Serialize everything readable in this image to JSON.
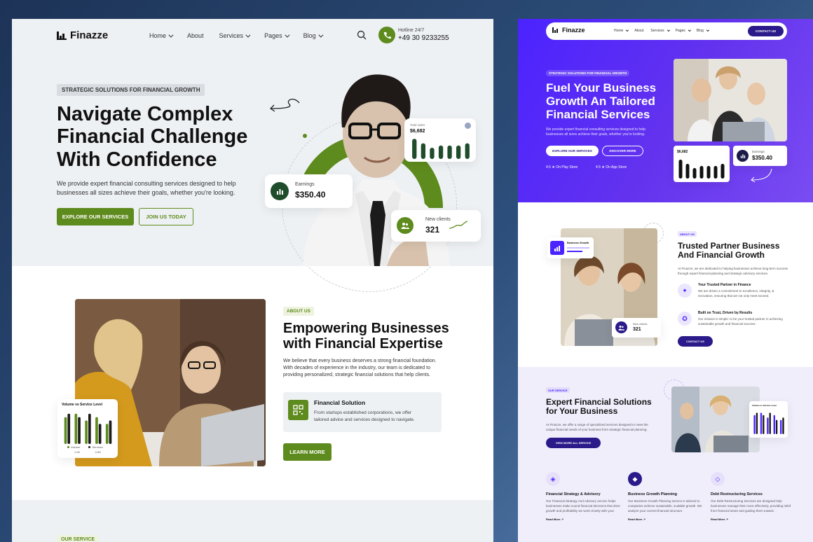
{
  "left": {
    "brand": "Finazze",
    "nav": [
      {
        "label": "Home"
      },
      {
        "label": "About"
      },
      {
        "label": "Services"
      },
      {
        "label": "Pages"
      },
      {
        "label": "Blog"
      }
    ],
    "hotline_label": "Hotline 24/7",
    "hotline_number": "+49 30 9233255",
    "hero": {
      "tag": "STRATEGIC SOLUTIONS FOR FINANCIAL GROWTH",
      "title_l1": "Navigate Complex",
      "title_l2": "Financial Challenge",
      "title_l3": "With Confidence",
      "desc_l1": "We provide expert financial consulting services designed to help",
      "desc_l2": "businesses all sizes achieve their goals, whether you're looking.",
      "btn_primary": "EXPLORE OUR SERVICES",
      "btn_secondary": "JOIN US TODAY",
      "stat_total_label": "Total sales",
      "stat_total_value": "$6,682",
      "earnings_label": "Earnings",
      "earnings_value": "$350.40",
      "clients_label": "New clients",
      "clients_value": "321"
    },
    "about": {
      "tag": "ABOUT US",
      "title_l1": "Empowering Businesses",
      "title_l2": "with Financial Expertise",
      "desc_l1": "We believe that every business deserves a strong financial foundation.",
      "desc_l2": "With decades of experience in the industry, our team is dedicated to",
      "desc_l3": "providing personalized, strategic financial solutions that help clients.",
      "feature_title": "Financial Solution",
      "feature_l1": "From startups established corporations, we offer",
      "feature_l2": "tailored advice and services designed to navigate.",
      "btn": "LEARN MORE",
      "chart_label": "Volume vs Service Level",
      "legend_a": "Volume",
      "legend_b": "Services",
      "legend_a_val": "1.05",
      "legend_b_val": "0.85"
    },
    "service_tag": "OUR SERVICE"
  },
  "right": {
    "brand": "Finazze",
    "nav": [
      {
        "label": "Home"
      },
      {
        "label": "About"
      },
      {
        "label": "Services"
      },
      {
        "label": "Pages"
      },
      {
        "label": "Blog"
      }
    ],
    "contact_btn": "CONTACT US",
    "hero": {
      "tag": "STRATEGIC SOLUTIONS FOR FINANCIAL GROWTH",
      "title_l1": "Fuel Your Business",
      "title_l2": "Growth An Tailored",
      "title_l3": "Financial Services",
      "desc_l1": "We provide expert financial consulting services designed to help",
      "desc_l2": "businesses all sizes achieve their goals, whether you're looking.",
      "btn_a": "EXPLORE OUR SERVICES",
      "btn_b": "DISCOVER MORE",
      "rating_play": "4.5 ★ On Play Store",
      "rating_app": "4.5 ★ On App Store",
      "mini_total": "$6,682",
      "earnings_label": "Earnings",
      "earnings_value": "$350.40"
    },
    "about": {
      "tag": "ABOUT US",
      "title_l1": "Trusted Partner Business",
      "title_l2": "And Financial Growth",
      "desc": "At Finazze, we are dedicated to helping businesses achieve long-term success through expert financial planning and strategic advisory services.",
      "f1_title": "Your Trusted Partner in Finance",
      "f1_desc": "We are driven a commitment to excellence, integrity, & innovation, ensuring that we not only meet exceed.",
      "f2_title": "Built on Trust, Driven by Results",
      "f2_desc": "Our mission is simple: to be your trusted partner in achieving sustainable growth and financial success.",
      "btn": "CONTACT US",
      "growth_label": "Business Growth",
      "clients_label": "New clients",
      "clients_value": "321"
    },
    "services": {
      "tag": "OUR SERVICE",
      "title_l1": "Expert Financial Solutions",
      "title_l2": "for Your Business",
      "desc": "At Finazze, we offer a range of specialized services designed to meet the unique financial needs of your business from strategic financial planning.",
      "btn": "VIEW MORE ALL SERVICE",
      "chart_label": "Volume vs Service Level",
      "items": [
        {
          "title": "Financial Strategy & Advisory",
          "desc": "Our Financial Strategy And Advisory service helps businesses make sound financial decisions that drive growth and profitability we work closely with your.",
          "link": "Read More"
        },
        {
          "title": "Business Growth Planning",
          "desc": "Our Business Growth Planning service is tailored to companies achieve sustainable, scalable growth. We analyze your current financial structure.",
          "link": "Read More"
        },
        {
          "title": "Debt Restructuring Services",
          "desc": "Our Debt Restructuring Services are designed help businesses manage their more effectively, providing relief from financial strain and guiding them toward.",
          "link": "Read More"
        }
      ]
    }
  },
  "colors": {
    "green": "#5e8b1d",
    "purple": "#4b23ff",
    "dark": "#111111"
  },
  "chart_data": [
    {
      "type": "bar",
      "title": "",
      "categories": [
        "1",
        "2",
        "3",
        "4",
        "5",
        "6",
        "7"
      ],
      "series": [
        {
          "values": [
            9,
            7,
            5,
            6,
            6,
            6,
            7
          ]
        }
      ]
    },
    {
      "type": "bar",
      "title": "Volume vs Service Level",
      "categories": [
        "1",
        "2",
        "3",
        "4",
        "5"
      ],
      "series": [
        {
          "name": "Volume",
          "values": [
            8,
            9,
            7,
            8,
            6
          ]
        },
        {
          "name": "Services",
          "values": [
            9,
            8,
            9,
            6,
            7
          ]
        }
      ]
    }
  ]
}
